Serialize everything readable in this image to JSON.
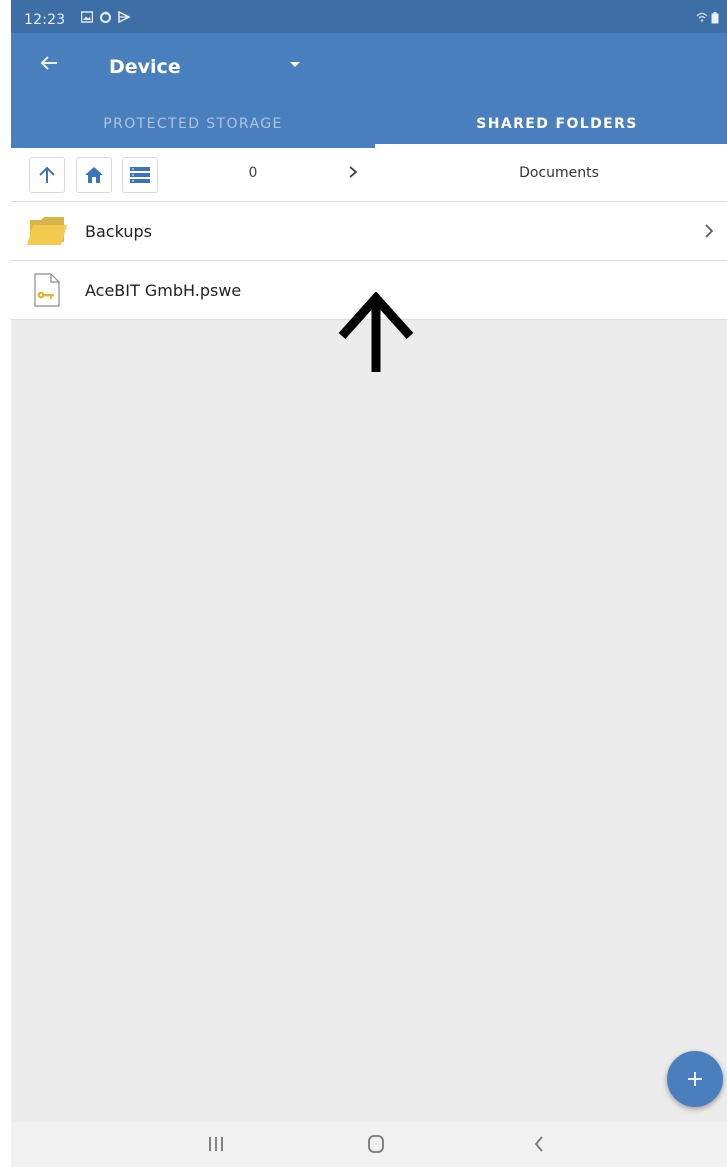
{
  "status_bar": {
    "time": "12:23",
    "icons": [
      "gallery-icon",
      "sync-icon",
      "play-store-icon"
    ],
    "right_icons": [
      "wifi-icon",
      "battery-icon"
    ]
  },
  "app_bar": {
    "title": "Device",
    "tabs": [
      {
        "label": "PROTECTED STORAGE",
        "selected": false
      },
      {
        "label": "SHARED FOLDERS",
        "selected": true
      }
    ],
    "accent_color": "#4a7fbd"
  },
  "toolbar": {
    "count": "0",
    "breadcrumb": "Documents"
  },
  "files": [
    {
      "name": "Backups",
      "type": "folder",
      "icon": "folder-icon"
    },
    {
      "name": "AceBIT GmbH.pswe",
      "type": "file",
      "icon": "key-file-icon"
    }
  ],
  "fab": {
    "icon": "plus-icon"
  },
  "nav_bar": {
    "buttons": [
      "recents-icon",
      "home-icon",
      "back-icon"
    ]
  }
}
